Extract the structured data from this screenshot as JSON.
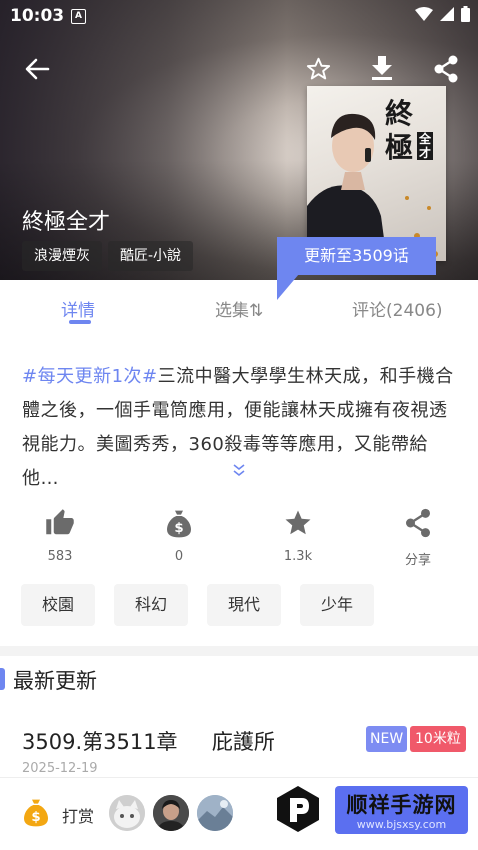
{
  "status_bar": {
    "time": "10:03",
    "notification_icon": "A"
  },
  "header": {
    "icons": [
      "back-arrow-icon",
      "star-outline-icon",
      "download-icon",
      "share-icon"
    ],
    "book_title": "終極全才",
    "tags": [
      "浪漫煙灰",
      "酷匠-小說"
    ],
    "cover_text_top": "終",
    "cover_text_mid": "極",
    "cover_text_side": "全才",
    "update_badge": "更新至3509话"
  },
  "tabs": [
    {
      "label": "详情",
      "active": true
    },
    {
      "label": "选集⇅",
      "active": false
    },
    {
      "label": "评论(2406)",
      "active": false
    }
  ],
  "description": {
    "hashtag": "#每天更新1次#",
    "text": "三流中醫大學學生林天成，和手機合體之後，一個手電筒應用，便能讓林天成擁有夜視透視能力。美圖秀秀，360殺毒等等應用，又能帶給他…"
  },
  "actions": [
    {
      "icon": "thumbs-up-icon",
      "count": "583"
    },
    {
      "icon": "money-bag-icon",
      "count": "0"
    },
    {
      "icon": "star-icon",
      "count": "1.3k"
    },
    {
      "icon": "share-icon",
      "count": "分享"
    }
  ],
  "genre_tags": [
    "校園",
    "科幻",
    "現代",
    "少年"
  ],
  "latest": {
    "section_title": "最新更新",
    "episode": "3509.第3511章 　 庇護所",
    "badge_new": "NEW",
    "badge_price": "10米粒",
    "date": "2025-12-19"
  },
  "bottom": {
    "reward_label": "打赏",
    "watermark_title": "顺祥手游网",
    "watermark_url": "www.bjsxsy.com"
  },
  "colors": {
    "accent": "#6e86f0",
    "price_red": "#f0596a",
    "new_badge": "#7d8cf2"
  }
}
